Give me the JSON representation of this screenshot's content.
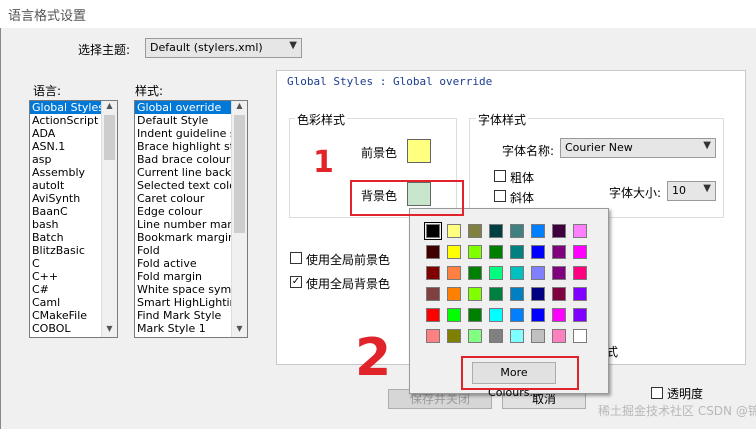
{
  "window": {
    "title": "语言格式设置"
  },
  "theme": {
    "label": "选择主题:",
    "value": "Default (stylers.xml)"
  },
  "language": {
    "label": "语言:",
    "items": [
      "Global Styles",
      "ActionScript",
      "ADA",
      "ASN.1",
      "asp",
      "Assembly",
      "autoIt",
      "AviSynth",
      "BaanC",
      "bash",
      "Batch",
      "BlitzBasic",
      "C",
      "C++",
      "C#",
      "Caml",
      "CMakeFile",
      "COBOL"
    ],
    "selected": 0
  },
  "style": {
    "label": "样式:",
    "items": [
      "Global override",
      "Default Style",
      "Indent guideline sty",
      "Brace highlight style",
      "Bad brace colour",
      "Current line backgr",
      "Selected text colou",
      "Caret colour",
      "Edge colour",
      "Line number margin",
      "Bookmark margin",
      "Fold",
      "Fold active",
      "Fold margin",
      "White space symbo",
      "Smart HighLighting",
      "Find Mark Style",
      "Mark Style 1"
    ],
    "selected": 0
  },
  "panel": {
    "header": "Global Styles : Global override"
  },
  "colour_style": {
    "title": "色彩样式",
    "foreground_label": "前景色",
    "foreground_color": "#ffff80",
    "background_label": "背景色",
    "background_color": "#c7e6cc"
  },
  "font_style": {
    "title": "字体样式",
    "name_label": "字体名称:",
    "name_value": "Courier New",
    "bold_label": "粗体",
    "italic_label": "斜体",
    "size_label": "字体大小:",
    "size_value": "10"
  },
  "global_fg": {
    "label": "使用全局前景色",
    "checked": false
  },
  "global_bg": {
    "label": "使用全局背景色",
    "checked": true
  },
  "palette": {
    "colors": [
      [
        "#000000",
        "#ffff80",
        "#808040",
        "#004040",
        "#408080",
        "#0080ff",
        "#400040",
        "#ff80ff"
      ],
      [
        "#400000",
        "#ffff00",
        "#80ff00",
        "#008000",
        "#008080",
        "#0000ff",
        "#800080",
        "#ff00ff"
      ],
      [
        "#800000",
        "#ff8040",
        "#008000",
        "#00ff80",
        "#00c0c0",
        "#8080ff",
        "#800080",
        "#ff0080"
      ],
      [
        "#804040",
        "#ff8000",
        "#80ff00",
        "#008040",
        "#0080c0",
        "#000080",
        "#800040",
        "#8000ff"
      ],
      [
        "#ff0000",
        "#00ff00",
        "#008000",
        "#00ffff",
        "#0080ff",
        "#0000ff",
        "#ff00ff",
        "#8000ff"
      ],
      [
        "#ff8080",
        "#808000",
        "#80ff80",
        "#808080",
        "#80ffff",
        "#c0c0c0",
        "#ff80c0",
        "#ffffff"
      ]
    ],
    "more_label": "More Colours..."
  },
  "partial_font_text": "式",
  "transparency_label": "透明度",
  "save_close_label": "保存并关闭",
  "cancel_label": "取消",
  "annotation_one": "1",
  "annotation_two": "2",
  "watermark": "稀土掘金技术社区 CSDN @锦瑟"
}
